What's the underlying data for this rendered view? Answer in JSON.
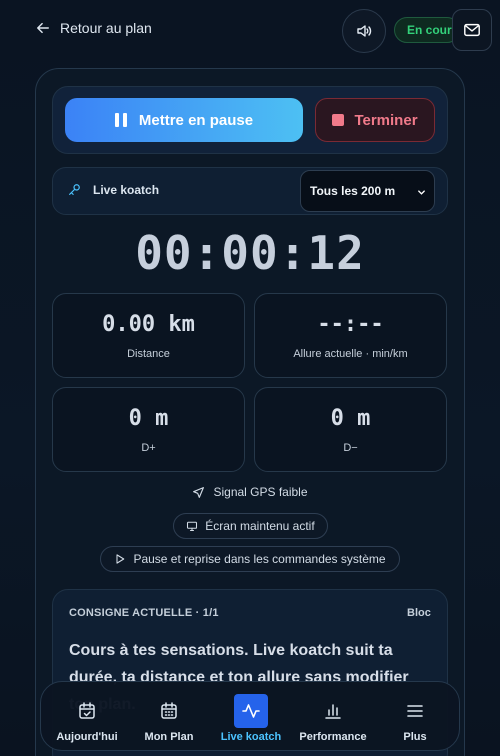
{
  "header": {
    "back_label": "Retour au plan",
    "status": "En cours"
  },
  "controls": {
    "pause_label": "Mettre en pause",
    "stop_label": "Terminer"
  },
  "coach": {
    "label": "Live koatch",
    "interval_value": "Tous les 200 m"
  },
  "timer": "00:00:12",
  "stats": [
    {
      "value": "0.00 km",
      "label": "Distance"
    },
    {
      "value": "--:--",
      "label": "Allure actuelle · min/km"
    },
    {
      "value": "0 m",
      "label": "D+"
    },
    {
      "value": "0 m",
      "label": "D−"
    }
  ],
  "info": {
    "gps": "Signal GPS faible",
    "screen": "Écran maintenu actif",
    "system": "Pause et reprise dans les commandes système"
  },
  "instruction": {
    "heading": "CONSIGNE ACTUELLE · 1/1",
    "type": "Bloc",
    "text": "Cours à tes sensations. Live koatch suit ta durée, ta distance et ton allure sans modifier ton plan."
  },
  "nav": [
    {
      "label": "Aujourd'hui",
      "icon": "calendar-check-icon"
    },
    {
      "label": "Mon Plan",
      "icon": "calendar-grid-icon"
    },
    {
      "label": "Live koatch",
      "icon": "activity-icon",
      "active": true
    },
    {
      "label": "Performance",
      "icon": "bar-chart-icon"
    },
    {
      "label": "Plus",
      "icon": "menu-icon"
    }
  ],
  "colors": {
    "accent": "#3b82f6",
    "status_green": "#33d17a",
    "stop_red": "#f07a8a",
    "active_nav_text": "#4cc3ff"
  }
}
